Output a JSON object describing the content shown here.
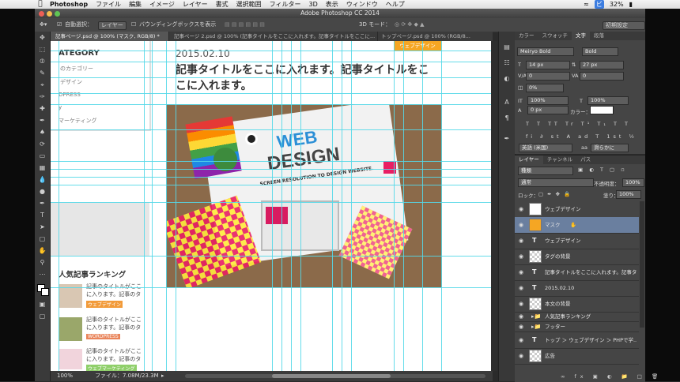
{
  "menubar": {
    "app": "Photoshop",
    "items": [
      "ファイル",
      "編集",
      "イメージ",
      "レイヤー",
      "書式",
      "選択範囲",
      "フィルター",
      "3D",
      "表示",
      "ウィンドウ",
      "ヘルプ"
    ],
    "battery": "32%",
    "user": "ビ"
  },
  "window": {
    "title": "Adobe Photoshop CC 2014"
  },
  "options": {
    "auto_select": "自動選択：",
    "auto_select_value": "レイヤー",
    "bounding_box": "バウンディングボックスを表示",
    "mode3d": "3D モード：",
    "workspace": "初期設定"
  },
  "tabs": [
    "記事ページ.psd @ 100% (マスク, RGB/8) *",
    "記事ページ 2.psd @ 100% (記事タイトルをここに入れます。記事タイトルをここに...",
    "トップページ.psd @ 100% (RGB/8..."
  ],
  "canvas": {
    "category_heading": "ATEGORY",
    "category_items": [
      "のカテゴリー",
      "デザイン",
      "DPRESS",
      "y",
      "マーケティング"
    ],
    "post_date": "2015.02.10",
    "tag_label": "ウェブデザイン",
    "post_title": "記事タイトルをここに入れます。記事タイトルをここに入れます。",
    "hero_word1": "WEB",
    "hero_word2": "DESIGN",
    "hero_sub": "SCREEN RESOLUTION TO DESIGN WEBSITE.",
    "ranking_heading": "人気記事ランキング",
    "ranking": [
      {
        "text": "記事のタイトルがここに入ります。記事のタ",
        "tag": "ウェブデザイン",
        "tag_color": "#f29b3a"
      },
      {
        "text": "記事のタイトルがここに入ります。記事のタ",
        "tag": "WORDPRESS",
        "tag_color": "#e9845a"
      },
      {
        "text": "記事のタイトルがここに入ります。記事のタ",
        "tag": "ウェブマーケティング",
        "tag_color": "#8fcf6a"
      }
    ]
  },
  "status": {
    "zoom": "100%",
    "file": "ファイル：7.08M/23.3M"
  },
  "char_panel": {
    "tabs": [
      "カラー",
      "スウォッチ",
      "文字",
      "段落"
    ],
    "active_tab": "文字",
    "font": "Meiryo Bold",
    "style": "Bold",
    "size": "14 px",
    "leading": "27 px",
    "kerning": "0",
    "tracking": "0",
    "tsume": "0%",
    "vscale": "100%",
    "hscale": "100%",
    "baseline": "0 px",
    "color_label": "カラー：",
    "lang": "英語 (米国)",
    "aa_label": "aa",
    "aa": "滑らかに"
  },
  "layers_panel": {
    "tabs": [
      "レイヤー",
      "チャンネル",
      "パス"
    ],
    "filter": "種類",
    "blend": "通常",
    "opacity_label": "不透明度：",
    "opacity": "100%",
    "lock_label": "ロック：",
    "fill_label": "塗り：",
    "fill": "100%",
    "layers": [
      {
        "name": "ウェブデザイン",
        "kind": "image",
        "selected": false
      },
      {
        "name": "マスク",
        "kind": "image",
        "selected": true
      },
      {
        "name": "ウェブデザイン",
        "kind": "text",
        "selected": false
      },
      {
        "name": "タグの背景",
        "kind": "checker",
        "selected": false
      },
      {
        "name": "記事タイトルをここに入れます。記事タ...",
        "kind": "text",
        "selected": false
      },
      {
        "name": "2015.02.10",
        "kind": "text",
        "selected": false
      },
      {
        "name": "本文の背景",
        "kind": "checker",
        "selected": false
      },
      {
        "name": "人気記事ランキング",
        "kind": "folder",
        "selected": false
      },
      {
        "name": "フッター",
        "kind": "folder",
        "selected": false
      },
      {
        "name": "トップ ＞ ウェブデザイン ＞ PHPで学...",
        "kind": "text",
        "selected": false
      },
      {
        "name": "広告",
        "kind": "checker",
        "selected": false
      }
    ]
  },
  "colors": {
    "guide": "#54d8e8",
    "selection": "#6a7f9f",
    "tag_orange": "#f5a623"
  }
}
